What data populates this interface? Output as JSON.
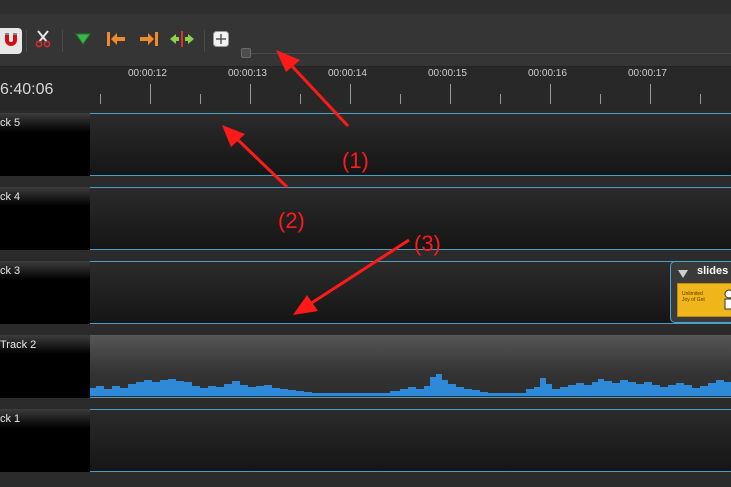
{
  "toolbar": {
    "tools": [
      {
        "name": "snap-magnet",
        "icon": "magnet-icon"
      },
      {
        "name": "razor",
        "icon": "scissors-icon"
      },
      {
        "name": "add-marker",
        "icon": "marker-icon"
      },
      {
        "name": "previous-marker",
        "icon": "jump-previous-icon"
      },
      {
        "name": "next-marker",
        "icon": "jump-next-icon"
      },
      {
        "name": "center-playhead",
        "icon": "center-icon"
      },
      {
        "name": "zoom-fit",
        "icon": "zoom-fit-icon"
      }
    ]
  },
  "ruler": {
    "current_time": "6:40:06",
    "ticks": [
      "00:00:12",
      "00:00:13",
      "00:00:14",
      "00:00:15",
      "00:00:16",
      "00:00:17"
    ]
  },
  "tracks": [
    {
      "name": "ck 5"
    },
    {
      "name": "ck 4"
    },
    {
      "name": "ck 3"
    },
    {
      "name": "Track 2"
    },
    {
      "name": "ck 1"
    }
  ],
  "clip": {
    "title": "slides",
    "thumb_text_1": "Unlimited",
    "thumb_text_2": "Joy of Gnt"
  },
  "annotations": [
    "(1)",
    "(2)",
    "(3)"
  ],
  "colors": {
    "accent": "#4a9ec2",
    "waveform": "#2e8ad8",
    "annotation": "#ff1a1a"
  }
}
